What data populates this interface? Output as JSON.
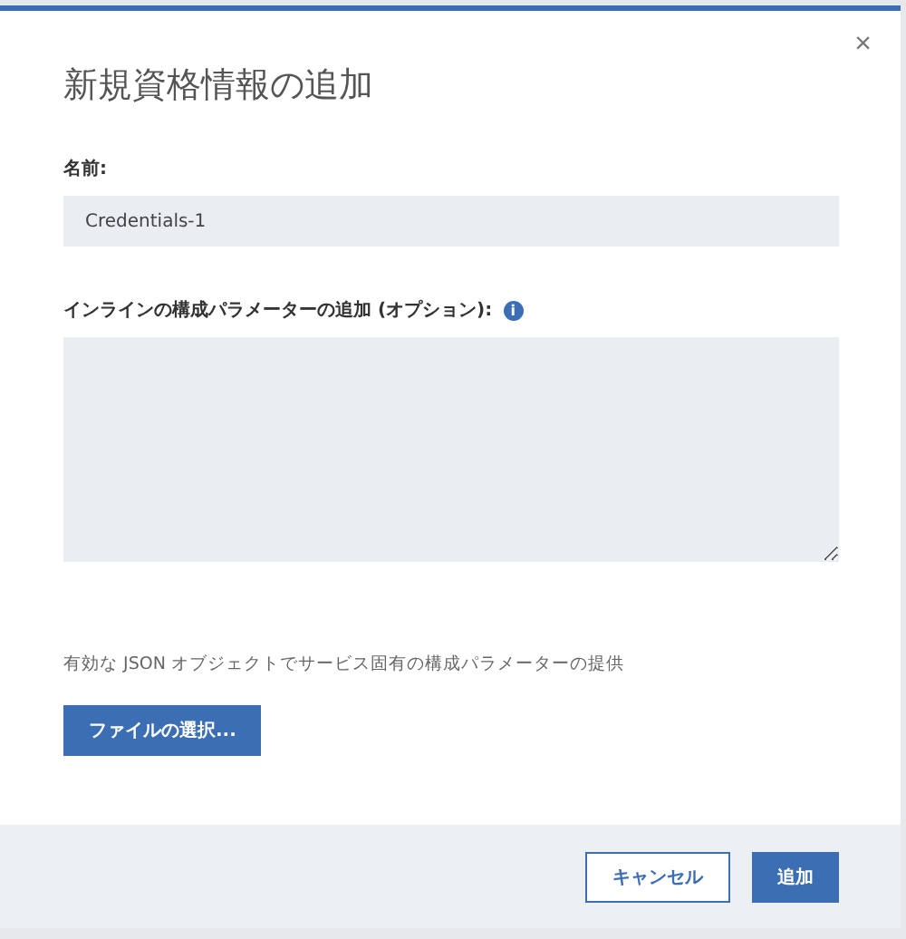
{
  "dialog": {
    "title": "新規資格情報の追加",
    "close": "×",
    "name_label": "名前:",
    "name_value": "Credentials-1",
    "params_label": "インラインの構成パラメーターの追加 (オプション):",
    "info_icon": "i",
    "help_text": "有効な JSON オブジェクトでサービス固有の構成パラメーターの提供",
    "file_button": "ファイルの選択...",
    "buttons": [
      {
        "label": "キャンセル",
        "kind": "secondary"
      },
      {
        "label": "追加",
        "kind": "primary"
      }
    ]
  }
}
